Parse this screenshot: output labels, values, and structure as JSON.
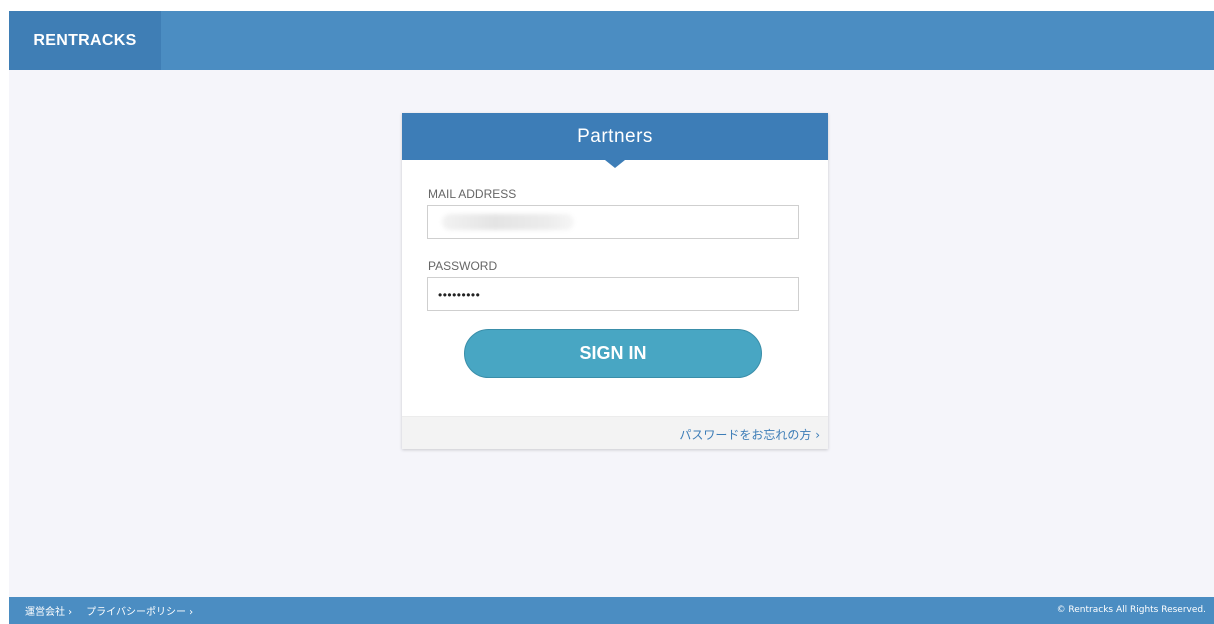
{
  "header": {
    "logo": "RENTRACKS"
  },
  "card": {
    "title": "Partners",
    "mail_label": "MAIL ADDRESS",
    "mail_value": "",
    "password_label": "PASSWORD",
    "password_value": "•••••••••",
    "signin_label": "SIGN IN",
    "forgot_link": "パスワードをお忘れの方 ›"
  },
  "footer": {
    "links": [
      "運営会社 ›",
      "プライバシーポリシー ›"
    ],
    "copyright": "© Rentracks All Rights Reserved."
  },
  "colors": {
    "header": "#4b8dc2",
    "logo_bg": "#3f7eb5",
    "card_head": "#3d7db7",
    "button": "#48a6c3",
    "page_bg": "#f5f5fa"
  }
}
